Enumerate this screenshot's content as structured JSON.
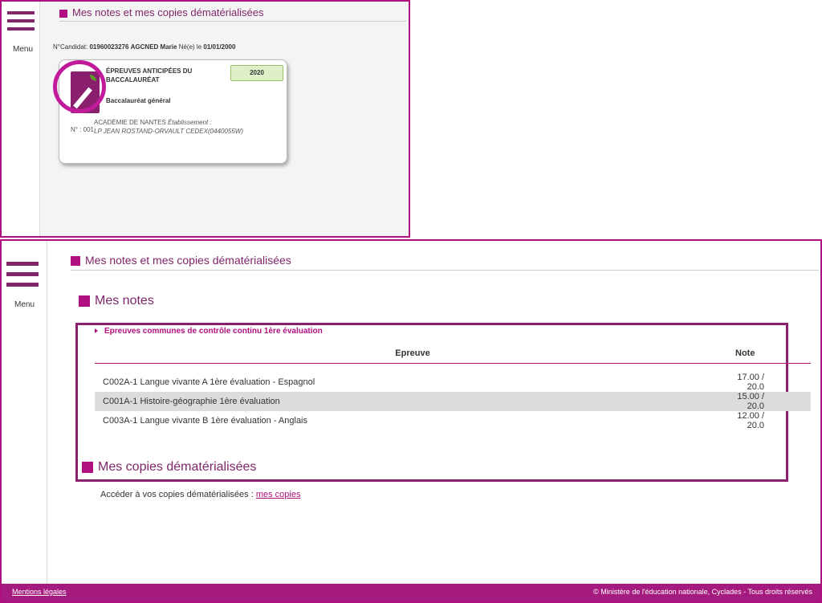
{
  "top_panel": {
    "menu_label": "Menu",
    "title": "Mes notes et mes copies dématérialisées",
    "candidate": {
      "num_label": "N°Candidat:",
      "num_value": "01960023276",
      "name": "AGCNED Marie",
      "born_label": "Né(e) le",
      "born_value": "01/01/2000"
    },
    "card": {
      "year": "2020",
      "exam_title": "ÉPREUVES ANTICIPÉES DU BACCALAURÉAT",
      "track": "Baccalauréat général",
      "academy": "ACADÉMIE DE NANTES",
      "etab_label": "Établissement :",
      "etab_value": "LP JEAN ROSTAND-ORVAULT CEDEX(0440055W)",
      "number": "N° : 001"
    }
  },
  "bottom_panel": {
    "menu_label": "Menu",
    "title": "Mes notes et mes copies dématérialisées",
    "notes_heading": "Mes notes",
    "section_label": "Epreuves communes de contrôle continu 1ère évaluation",
    "table": {
      "headers": {
        "epreuve": "Epreuve",
        "note": "Note"
      },
      "rows": [
        {
          "epreuve": "C002A-1 Langue vivante A 1ère évaluation - Espagnol",
          "note": "17.00 / 20.0"
        },
        {
          "epreuve": "C001A-1 Histoire-géographie 1ère évaluation",
          "note": "15.00 / 20.0"
        },
        {
          "epreuve": "C003A-1 Langue vivante B 1ère évaluation - Anglais",
          "note": "12.00 / 20.0"
        }
      ]
    },
    "copies_heading": "Mes copies dématérialisées",
    "access_text": "Accéder à vos copies dématérialisées :",
    "access_link": "mes copies"
  },
  "footer": {
    "legal": "Mentions légales",
    "copyright": "© Ministère de l'éducation nationale, Cyclades - Tous droits réservés"
  },
  "colors": {
    "accent": "#b0107f",
    "dark_accent": "#80266b",
    "footer": "#a51a7e",
    "year_badge": "#dff0c8"
  }
}
